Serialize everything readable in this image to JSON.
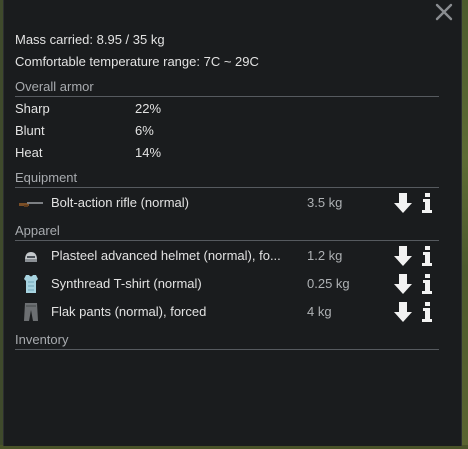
{
  "summary": {
    "mass_carried": "Mass carried: 8.95 / 35 kg",
    "comfortable_temp": "Comfortable temperature range: 7C ~ 29C"
  },
  "overall_armor": {
    "title": "Overall armor",
    "stats": [
      {
        "label": "Sharp",
        "value": "22%"
      },
      {
        "label": "Blunt",
        "value": "6%"
      },
      {
        "label": "Heat",
        "value": "14%"
      }
    ]
  },
  "equipment": {
    "title": "Equipment",
    "items": [
      {
        "name": "Bolt-action rifle (normal)",
        "mass": "3.5 kg",
        "icon": "rifle-icon"
      }
    ]
  },
  "apparel": {
    "title": "Apparel",
    "items": [
      {
        "name": "Plasteel advanced helmet (normal), fo...",
        "mass": "1.2 kg",
        "icon": "helmet-icon"
      },
      {
        "name": "Synthread T-shirt (normal)",
        "mass": "0.25 kg",
        "icon": "tshirt-icon"
      },
      {
        "name": "Flak pants (normal), forced",
        "mass": "4 kg",
        "icon": "pants-icon"
      }
    ]
  },
  "inventory": {
    "title": "Inventory",
    "items": []
  },
  "icons": {
    "close": "close-icon",
    "drop": "drop-arrow-icon",
    "info": "info-icon"
  },
  "colors": {
    "panel_bg": "#1a1c1e",
    "text": "#e2e2e2",
    "section_text": "#a8abaf",
    "divider": "#565a5f"
  }
}
